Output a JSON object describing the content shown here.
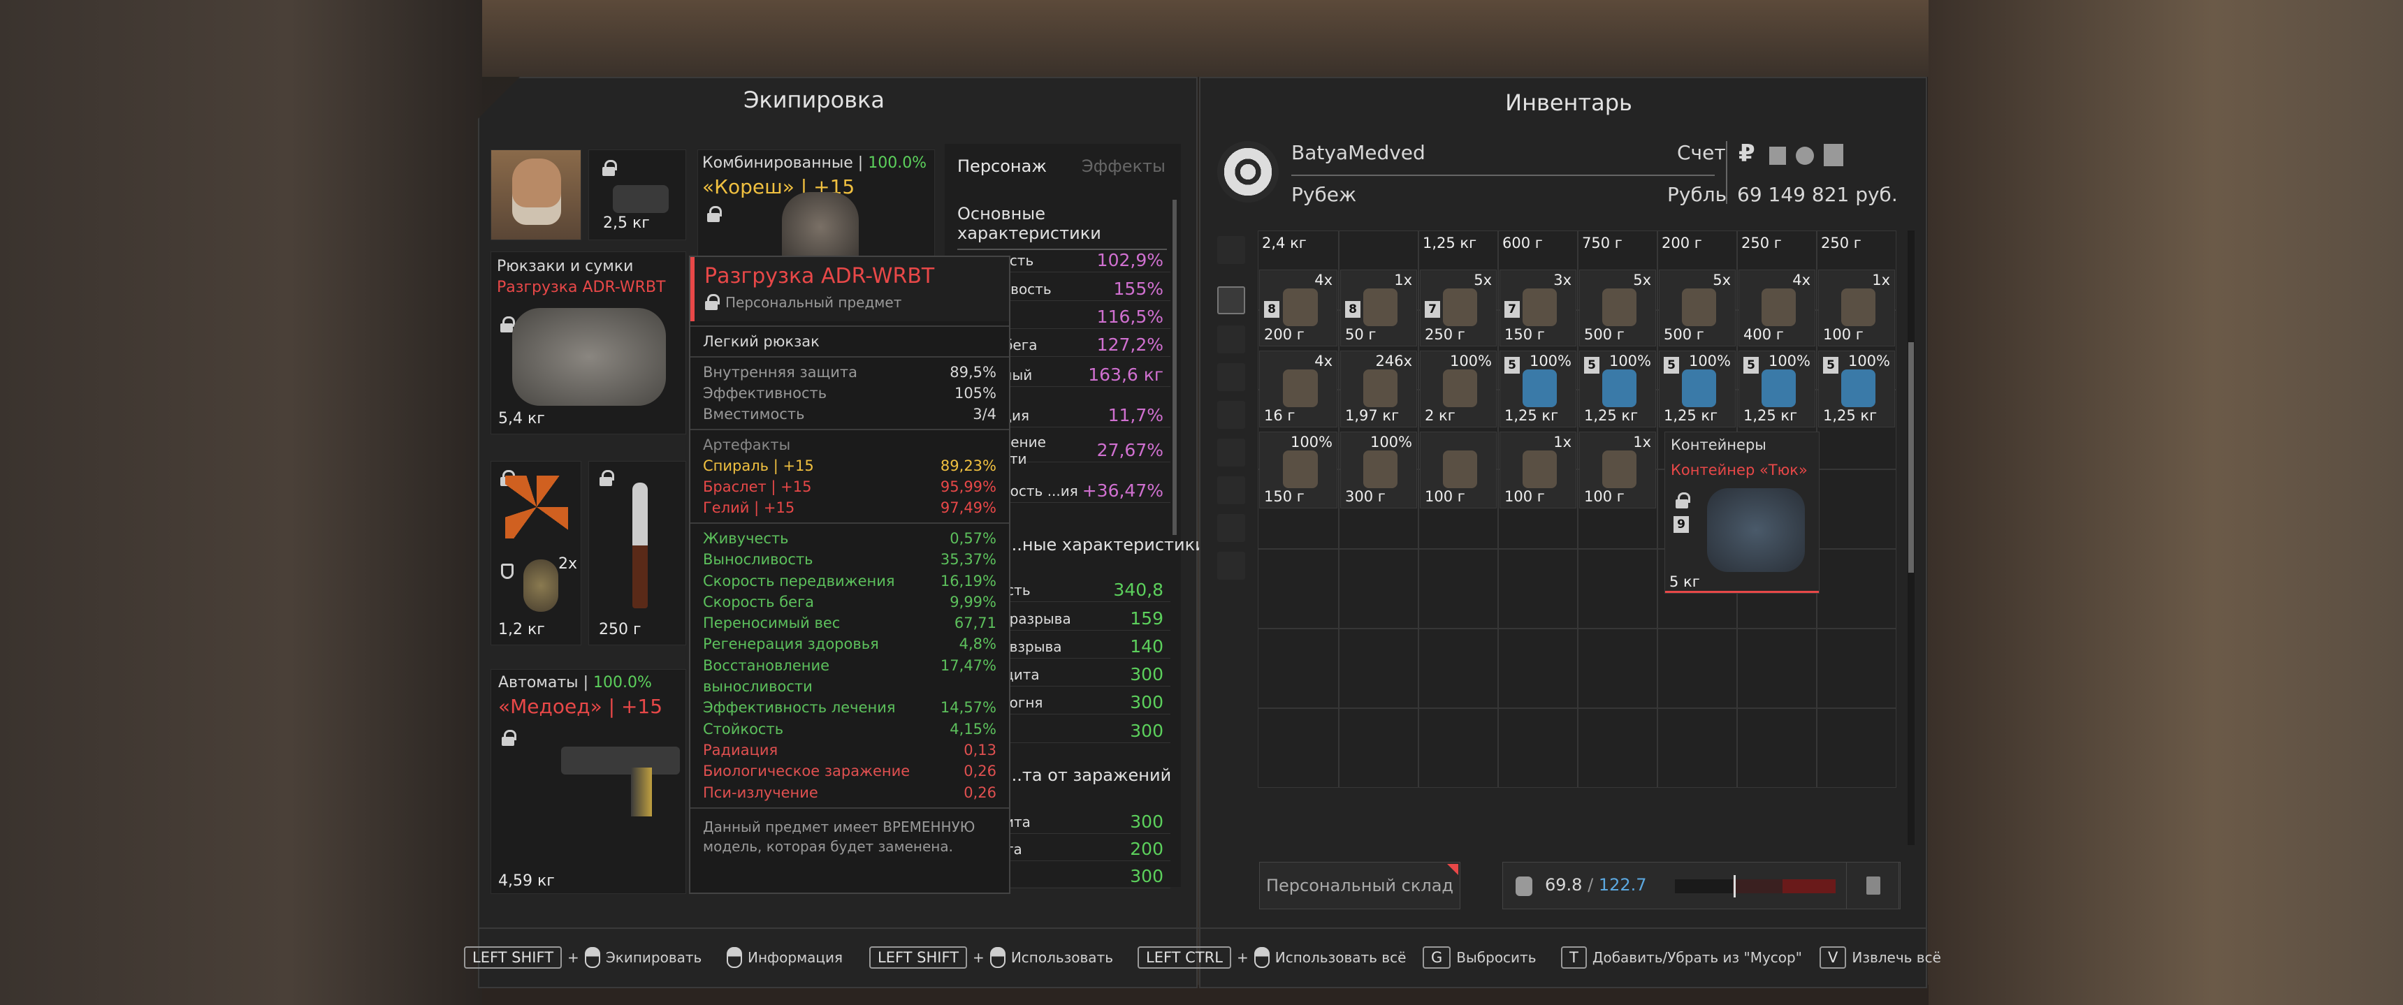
{
  "equipment": {
    "title": "Экипировка",
    "helmet_weight": "2,5 кг",
    "armor": {
      "header": "Комбинированные",
      "sep": "|",
      "percent": "100.0%",
      "name": "«Кореш» | +15"
    },
    "backpack": {
      "header": "Рюкзаки и сумки",
      "name": "Разгрузка ADR-WRBT",
      "weight": "5,4 кг"
    },
    "belt": {
      "count": "2x",
      "weight": "1,2 кг"
    },
    "knife": {
      "weight": "250 г"
    },
    "weapon": {
      "header": "Автоматы",
      "sep": "|",
      "percent": "100.0%",
      "name": "«Медоед» | +15",
      "weight": "4,59 кг"
    }
  },
  "tooltip": {
    "title": "Разгрузка ADR-WRBT",
    "subtitle": "Персональный предмет",
    "type": "Легкий рюкзак",
    "props": [
      {
        "k": "Внутренняя защита",
        "v": "89,5%"
      },
      {
        "k": "Эффективность",
        "v": "105%"
      },
      {
        "k": "Вместимость",
        "v": "3/4"
      }
    ],
    "artifacts_title": "Артефакты",
    "artifacts": [
      {
        "k": "Спираль | +15",
        "v": "89,23%",
        "c": "#f0c040"
      },
      {
        "k": "Браслет | +15",
        "v": "95,99%",
        "c": "#e84848"
      },
      {
        "k": "Гелий | +15",
        "v": "97,49%",
        "c": "#e84848"
      }
    ],
    "stats": [
      {
        "k": "Живучесть",
        "v": "0,57%",
        "c": "#5cc05c"
      },
      {
        "k": "Выносливость",
        "v": "35,37%",
        "c": "#5cc05c"
      },
      {
        "k": "Скорость передвижения",
        "v": "16,19%",
        "c": "#5cc05c"
      },
      {
        "k": "Скорость бега",
        "v": "9,99%",
        "c": "#5cc05c"
      },
      {
        "k": "Переносимый вес",
        "v": "67,71",
        "c": "#5cc05c"
      },
      {
        "k": "Регенерация здоровья",
        "v": "4,8%",
        "c": "#5cc05c"
      },
      {
        "k": "Восстановление выносливости",
        "v": "17,47%",
        "c": "#5cc05c"
      },
      {
        "k": "Эффективность лечения",
        "v": "14,57%",
        "c": "#5cc05c"
      },
      {
        "k": "Стойкость",
        "v": "4,15%",
        "c": "#5cc05c"
      },
      {
        "k": "Радиация",
        "v": "0,13",
        "c": "#e05050"
      },
      {
        "k": "Биологическое заражение",
        "v": "0,26",
        "c": "#e05050"
      },
      {
        "k": "Пси-излучение",
        "v": "0,26",
        "c": "#e05050"
      }
    ],
    "note": "Данный предмет имеет ВРЕМЕННУЮ модель, которая будет заменена."
  },
  "stats_panel": {
    "tab_char": "Персонаж",
    "tab_eff": "Эффекты",
    "main_title": "Основные характеристики",
    "main": [
      {
        "k": "...ивучесть",
        "v": "102,9%"
      },
      {
        "k": "...носливость",
        "v": "155%"
      },
      {
        "k": "...ость",
        "v": "116,5%"
      },
      {
        "k": "...ость бега",
        "v": "127,2%"
      },
      {
        "k": "...носимый",
        "v": "163,6 кг"
      },
      {
        "k": "...нерация",
        "v": "11,7%"
      },
      {
        "k": "...ановление ...ливости",
        "v": "27,67%"
      },
      {
        "k": "...ктивность ...ия",
        "v": "+36,47%"
      }
    ],
    "prot_title": "...ные характеристики",
    "prot": [
      {
        "k": "Стойкость",
        "v": "340,8"
      },
      {
        "k": "...та от разрыва",
        "v": "159"
      },
      {
        "k": "...та от взрыва",
        "v": "140"
      },
      {
        "k": "...розащита",
        "v": "300"
      },
      {
        "k": "...та от огня",
        "v": "300"
      },
      {
        "k": "...щита",
        "v": "300"
      }
    ],
    "inf_title": "...та от заражений",
    "inf": [
      {
        "k": "...озащита",
        "v": "300"
      },
      {
        "k": "...защита",
        "v": "200"
      },
      {
        "k": "...щита",
        "v": "300"
      }
    ]
  },
  "inventory": {
    "title": "Инвентарь",
    "player": "BatyaMedved",
    "faction": "Рубеж",
    "account_label": "Счет",
    "currency_label": "Рубль",
    "balance": "69 149 821 руб.",
    "top_weights": [
      "2,4 кг",
      "",
      "1,25 кг",
      "600 г",
      "750 г",
      "200 г",
      "250 г",
      "250 г"
    ],
    "row1": [
      {
        "q": "4x",
        "w": "200 г",
        "n": "8"
      },
      {
        "q": "1x",
        "w": "50 г",
        "n": "8"
      },
      {
        "q": "5x",
        "w": "250 г",
        "n": "7"
      },
      {
        "q": "3x",
        "w": "150 г",
        "n": "7"
      },
      {
        "q": "5x",
        "w": "500 г"
      },
      {
        "q": "5x",
        "w": "500 г"
      },
      {
        "q": "4x",
        "w": "400 г"
      },
      {
        "q": "1x",
        "w": "100 г"
      }
    ],
    "row2": [
      {
        "q": "4x",
        "w": "16 г"
      },
      {
        "q": "246x",
        "w": "1,97 кг"
      },
      {
        "q": "100%",
        "w": "2 кг"
      },
      {
        "q": "100%",
        "w": "1,25 кг",
        "n": "5"
      },
      {
        "q": "100%",
        "w": "1,25 кг",
        "n": "5"
      },
      {
        "q": "100%",
        "w": "1,25 кг",
        "n": "5"
      },
      {
        "q": "100%",
        "w": "1,25 кг",
        "n": "5"
      },
      {
        "q": "100%",
        "w": "1,25 кг",
        "n": "5"
      }
    ],
    "row3": [
      {
        "q": "100%",
        "w": "150 г"
      },
      {
        "q": "100%",
        "w": "300 г"
      },
      {
        "q": "",
        "w": "100 г"
      },
      {
        "q": "1x",
        "w": "100 г"
      },
      {
        "q": "1x",
        "w": "100 г"
      }
    ],
    "container": {
      "header": "Контейнеры",
      "name": "Контейнер «Тюк»",
      "num": "9",
      "weight": "5 кг"
    },
    "stash": "Персональный склад",
    "weight_current": "69.8",
    "weight_sep": "/",
    "weight_max": "122.7"
  },
  "hints": [
    {
      "key": "LEFT SHIFT",
      "plus": "+",
      "label": "Экипировать",
      "mouse": true
    },
    {
      "key": "",
      "plus": "",
      "label": "Информация",
      "mouse": true
    },
    {
      "key": "LEFT SHIFT",
      "plus": "+",
      "label": "Использовать",
      "mouse": true
    },
    {
      "key": "LEFT CTRL",
      "plus": "+",
      "label": "Использовать всё",
      "mouse": true
    },
    {
      "key": "G",
      "plus": "",
      "label": "Выбросить",
      "mouse": false
    },
    {
      "key": "T",
      "plus": "",
      "label": "Добавить/Убрать из \"Мусор\"",
      "mouse": false
    },
    {
      "key": "V",
      "plus": "",
      "label": "Извлечь всё",
      "mouse": false
    }
  ]
}
